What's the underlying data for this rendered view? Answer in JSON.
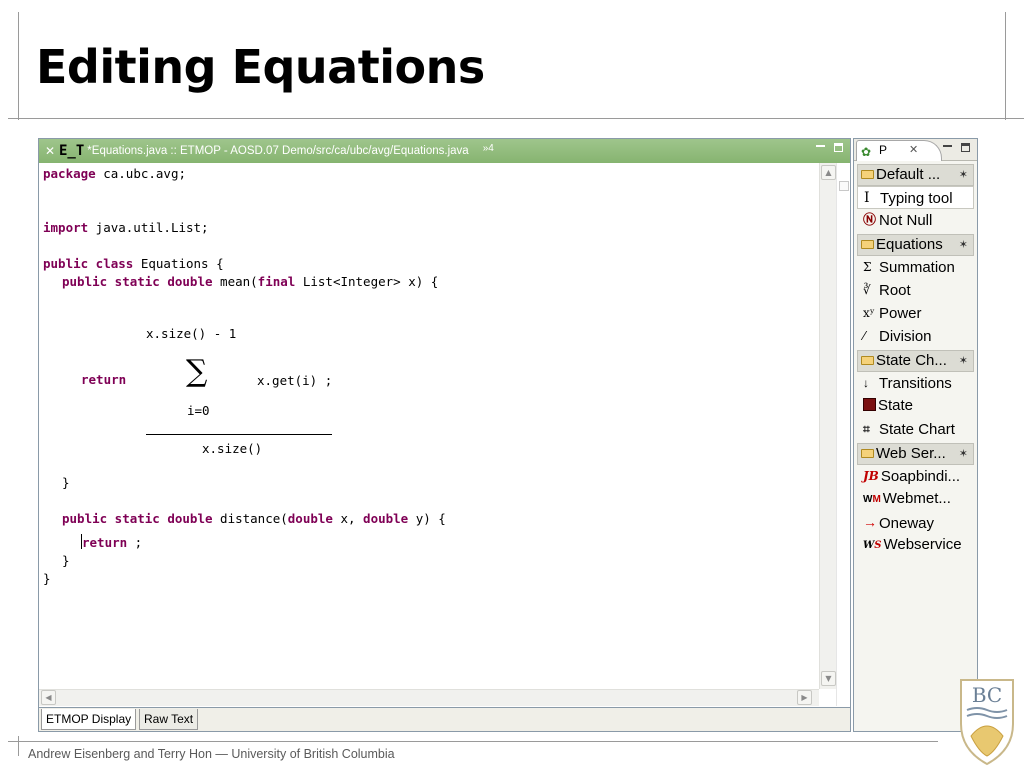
{
  "slide": {
    "title": "Editing Equations",
    "footer": "Andrew Eisenberg and Terry Hon — University of British Columbia",
    "logo_text": "BC"
  },
  "editor": {
    "tab_title": "*Equations.java :: ETMOP - AOSD.07 Demo/src/ca/ubc/avg/Equations.java",
    "tab_overflow": "»4",
    "code": {
      "package_kw": "package",
      "package_name": " ca.ubc.avg;",
      "import_kw": "import",
      "import_name": " java.util.List;",
      "class_kw": "public class",
      "class_name": " Equations {",
      "mean_kw1": "public static double",
      "mean_name": " mean(",
      "mean_kw2": "final",
      "mean_params": " List<Integer> x) {",
      "upper_limit": "x.size() - 1",
      "return_kw": "return",
      "sigma": "∑",
      "summand": "x.get(i) ;",
      "lower_limit": "i=0",
      "denominator": "x.size()",
      "close_mean": "}",
      "dist_kw1": "public static double",
      "dist_name": " distance(",
      "dist_kw2": "double",
      "dist_p1": " x, ",
      "dist_kw3": "double",
      "dist_p2": " y) {",
      "return2_kw": "return",
      "return2_rest": " ;",
      "close_dist": "}",
      "close_class": "}"
    },
    "bottom_tabs": [
      "ETMOP Display",
      "Raw Text"
    ],
    "active_bottom_tab": 0
  },
  "palette": {
    "tab_label": "P",
    "drawers": [
      {
        "label": "Default ...",
        "items": [
          {
            "icon": "cursor-icon",
            "label": "Typing tool",
            "selected": true
          },
          {
            "icon": "not-null-icon",
            "label": "Not Null"
          }
        ]
      },
      {
        "label": "Equations",
        "items": [
          {
            "icon": "summation-icon",
            "label": "Summation"
          },
          {
            "icon": "root-icon",
            "label": "Root"
          },
          {
            "icon": "power-icon",
            "label": "Power"
          },
          {
            "icon": "division-icon",
            "label": "Division"
          }
        ]
      },
      {
        "label": "State Ch...",
        "items": [
          {
            "icon": "transition-arrow-icon",
            "label": "Transitions"
          },
          {
            "icon": "state-icon",
            "label": "State"
          },
          {
            "icon": "state-chart-icon",
            "label": "State Chart"
          }
        ]
      },
      {
        "label": "Web Ser...",
        "items": [
          {
            "icon": "soapbinding-icon",
            "label": "Soapbindi..."
          },
          {
            "icon": "webmethod-icon",
            "label": "Webmet..."
          },
          {
            "icon": "oneway-arrow-icon",
            "label": "Oneway"
          },
          {
            "icon": "webservice-icon",
            "label": "Webservice"
          }
        ]
      }
    ],
    "icon_glyphs": {
      "sum": "Σ",
      "root": "∛",
      "power": "xʸ",
      "division": "⁄",
      "transition": "↓",
      "chart": "⌗",
      "soap": "JB",
      "wm_w": "W",
      "wm_m": "M",
      "oneway": "→",
      "ws_w": "W",
      "ws_s": "S",
      "null": "Ⓝ",
      "cursor": "I",
      "pin": "✶"
    }
  },
  "colors": {
    "keyword": "#7f0055",
    "tab_green": "#86b470"
  }
}
